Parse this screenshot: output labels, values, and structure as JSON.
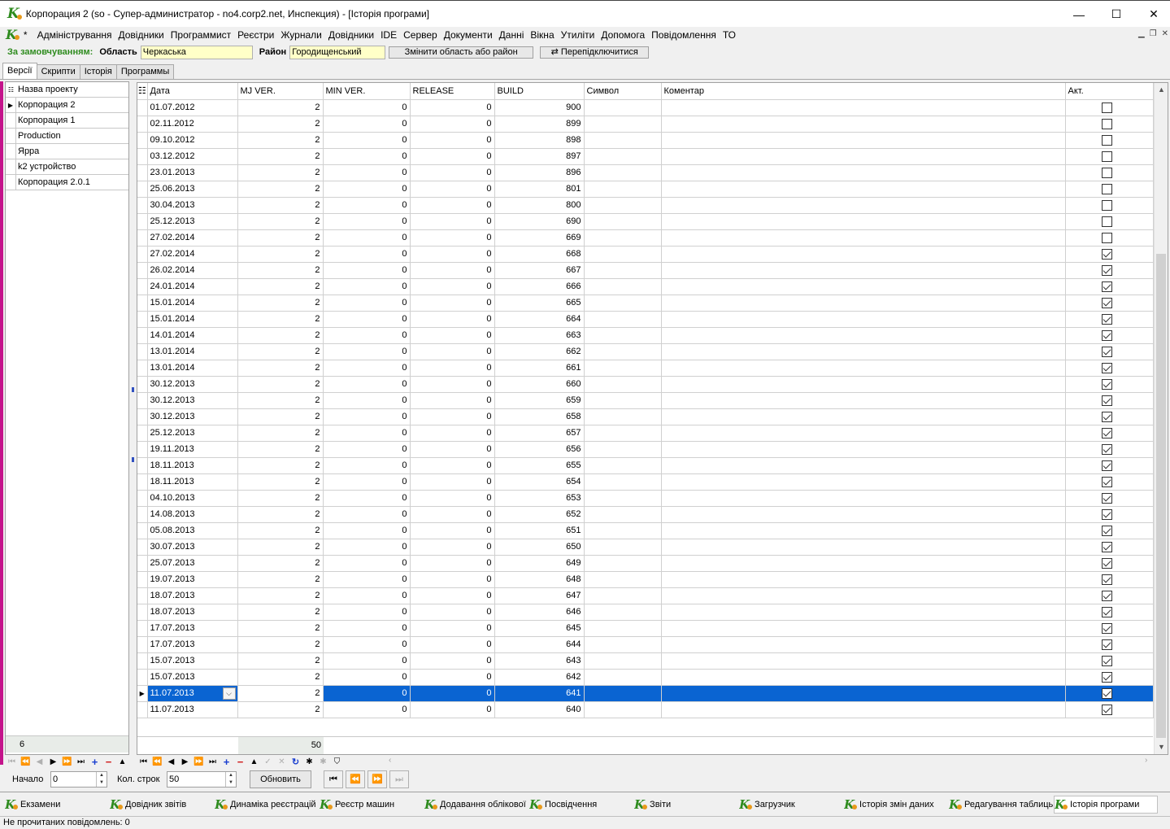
{
  "window": {
    "title": "Корпорация 2 (so - Супер-администратор - no4.corp2.net, Инспекция) - [Історія програми]",
    "min": "—",
    "max": "☐",
    "close": "✕"
  },
  "menu": {
    "star": "*",
    "items": [
      "Адміністрування",
      "Довідники",
      "Программист",
      "Реєстри",
      "Журнали",
      "Довідники",
      "IDE",
      "Сервер",
      "Документи",
      "Данні",
      "Вікна",
      "Утиліти",
      "Допомога",
      "Повідомлення",
      "ТО"
    ]
  },
  "filter": {
    "default_label": "За замовчуванням:",
    "region_label": "Область",
    "region_value": "Черкаська",
    "district_label": "Район",
    "district_value": "Городищенський",
    "change_button": "Змінити область або район",
    "reconnect_button": "Перепідключитися"
  },
  "tabs": [
    "Версії",
    "Скрипти",
    "Історія",
    "Программы"
  ],
  "projects": {
    "header": "Назва проекту",
    "items": [
      "Корпорация 2",
      "Корпорация 1",
      "Production",
      "Ярра",
      "k2 устройство",
      "Корпорация 2.0.1"
    ],
    "count": "6"
  },
  "grid": {
    "columns": [
      "Дата",
      "MJ VER.",
      "MIN VER.",
      "RELEASE",
      "BUILD",
      "Символ",
      "Коментар",
      "Акт."
    ],
    "rows": [
      {
        "date": "01.07.2012",
        "mj": "2",
        "min": "0",
        "rel": "0",
        "build": "900",
        "act": false
      },
      {
        "date": "02.11.2012",
        "mj": "2",
        "min": "0",
        "rel": "0",
        "build": "899",
        "act": false
      },
      {
        "date": "09.10.2012",
        "mj": "2",
        "min": "0",
        "rel": "0",
        "build": "898",
        "act": false
      },
      {
        "date": "03.12.2012",
        "mj": "2",
        "min": "0",
        "rel": "0",
        "build": "897",
        "act": false
      },
      {
        "date": "23.01.2013",
        "mj": "2",
        "min": "0",
        "rel": "0",
        "build": "896",
        "act": false
      },
      {
        "date": "25.06.2013",
        "mj": "2",
        "min": "0",
        "rel": "0",
        "build": "801",
        "act": false
      },
      {
        "date": "30.04.2013",
        "mj": "2",
        "min": "0",
        "rel": "0",
        "build": "800",
        "act": false
      },
      {
        "date": "25.12.2013",
        "mj": "2",
        "min": "0",
        "rel": "0",
        "build": "690",
        "act": false
      },
      {
        "date": "27.02.2014",
        "mj": "2",
        "min": "0",
        "rel": "0",
        "build": "669",
        "act": false
      },
      {
        "date": "27.02.2014",
        "mj": "2",
        "min": "0",
        "rel": "0",
        "build": "668",
        "act": true
      },
      {
        "date": "26.02.2014",
        "mj": "2",
        "min": "0",
        "rel": "0",
        "build": "667",
        "act": true
      },
      {
        "date": "24.01.2014",
        "mj": "2",
        "min": "0",
        "rel": "0",
        "build": "666",
        "act": true
      },
      {
        "date": "15.01.2014",
        "mj": "2",
        "min": "0",
        "rel": "0",
        "build": "665",
        "act": true
      },
      {
        "date": "15.01.2014",
        "mj": "2",
        "min": "0",
        "rel": "0",
        "build": "664",
        "act": true
      },
      {
        "date": "14.01.2014",
        "mj": "2",
        "min": "0",
        "rel": "0",
        "build": "663",
        "act": true
      },
      {
        "date": "13.01.2014",
        "mj": "2",
        "min": "0",
        "rel": "0",
        "build": "662",
        "act": true
      },
      {
        "date": "13.01.2014",
        "mj": "2",
        "min": "0",
        "rel": "0",
        "build": "661",
        "act": true
      },
      {
        "date": "30.12.2013",
        "mj": "2",
        "min": "0",
        "rel": "0",
        "build": "660",
        "act": true
      },
      {
        "date": "30.12.2013",
        "mj": "2",
        "min": "0",
        "rel": "0",
        "build": "659",
        "act": true
      },
      {
        "date": "30.12.2013",
        "mj": "2",
        "min": "0",
        "rel": "0",
        "build": "658",
        "act": true
      },
      {
        "date": "25.12.2013",
        "mj": "2",
        "min": "0",
        "rel": "0",
        "build": "657",
        "act": true
      },
      {
        "date": "19.11.2013",
        "mj": "2",
        "min": "0",
        "rel": "0",
        "build": "656",
        "act": true
      },
      {
        "date": "18.11.2013",
        "mj": "2",
        "min": "0",
        "rel": "0",
        "build": "655",
        "act": true
      },
      {
        "date": "18.11.2013",
        "mj": "2",
        "min": "0",
        "rel": "0",
        "build": "654",
        "act": true
      },
      {
        "date": "04.10.2013",
        "mj": "2",
        "min": "0",
        "rel": "0",
        "build": "653",
        "act": true
      },
      {
        "date": "14.08.2013",
        "mj": "2",
        "min": "0",
        "rel": "0",
        "build": "652",
        "act": true
      },
      {
        "date": "05.08.2013",
        "mj": "2",
        "min": "0",
        "rel": "0",
        "build": "651",
        "act": true
      },
      {
        "date": "30.07.2013",
        "mj": "2",
        "min": "0",
        "rel": "0",
        "build": "650",
        "act": true
      },
      {
        "date": "25.07.2013",
        "mj": "2",
        "min": "0",
        "rel": "0",
        "build": "649",
        "act": true
      },
      {
        "date": "19.07.2013",
        "mj": "2",
        "min": "0",
        "rel": "0",
        "build": "648",
        "act": true
      },
      {
        "date": "18.07.2013",
        "mj": "2",
        "min": "0",
        "rel": "0",
        "build": "647",
        "act": true
      },
      {
        "date": "18.07.2013",
        "mj": "2",
        "min": "0",
        "rel": "0",
        "build": "646",
        "act": true
      },
      {
        "date": "17.07.2013",
        "mj": "2",
        "min": "0",
        "rel": "0",
        "build": "645",
        "act": true
      },
      {
        "date": "17.07.2013",
        "mj": "2",
        "min": "0",
        "rel": "0",
        "build": "644",
        "act": true
      },
      {
        "date": "15.07.2013",
        "mj": "2",
        "min": "0",
        "rel": "0",
        "build": "643",
        "act": true
      },
      {
        "date": "15.07.2013",
        "mj": "2",
        "min": "0",
        "rel": "0",
        "build": "642",
        "act": true
      },
      {
        "date": "11.07.2013",
        "mj": "2",
        "min": "0",
        "rel": "0",
        "build": "641",
        "act": true,
        "selected": true
      },
      {
        "date": "11.07.2013",
        "mj": "2",
        "min": "0",
        "rel": "0",
        "build": "640",
        "act": true
      }
    ],
    "footer_total": "50",
    "selected_indicator": "▶",
    "header_icon": "☷"
  },
  "paging": {
    "start_label": "Начало",
    "start_value": "0",
    "rows_label": "Кол. строк",
    "rows_value": "50",
    "refresh_button": "Обновить"
  },
  "taskbar": [
    "Екзамени",
    "Довідник звітів",
    "Динаміка реєстрацій",
    "Реєстр машин",
    "Додавання облікової",
    "Посвідчення",
    "Звіти",
    "Загрузчик",
    "Історія змін даних",
    "Редагування таблиць",
    "Історія програми"
  ],
  "status": "Не прочитаних повідомлень: 0",
  "icons": {
    "logo": "k-logo-icon",
    "brand_green": "#2e8b1e",
    "brand_orange": "#e89a1c",
    "selection_blue": "#0a64d2",
    "filter_yellow": "#ffffc8"
  }
}
